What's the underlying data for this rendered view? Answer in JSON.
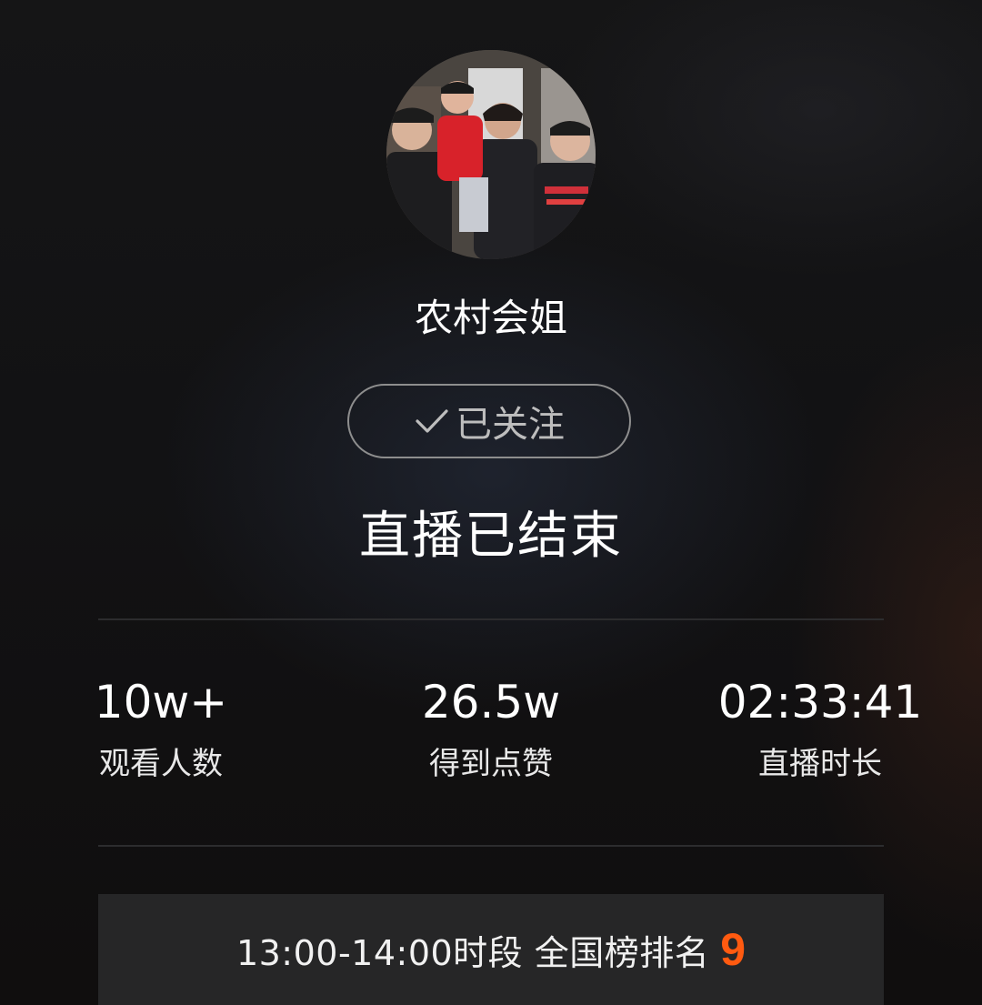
{
  "profile": {
    "name": "农村会姐",
    "follow_label": "已关注"
  },
  "status": {
    "title": "直播已结束"
  },
  "stats": [
    {
      "value": "10w+",
      "label": "观看人数"
    },
    {
      "value": "26.5w",
      "label": "得到点赞"
    },
    {
      "value": "02:33:41",
      "label": "直播时长"
    }
  ],
  "ranking": {
    "text": "13:00-14:00时段 全国榜排名",
    "number": "9",
    "number_color": "#ff5a10"
  },
  "icons": {
    "follow": "check-icon"
  }
}
